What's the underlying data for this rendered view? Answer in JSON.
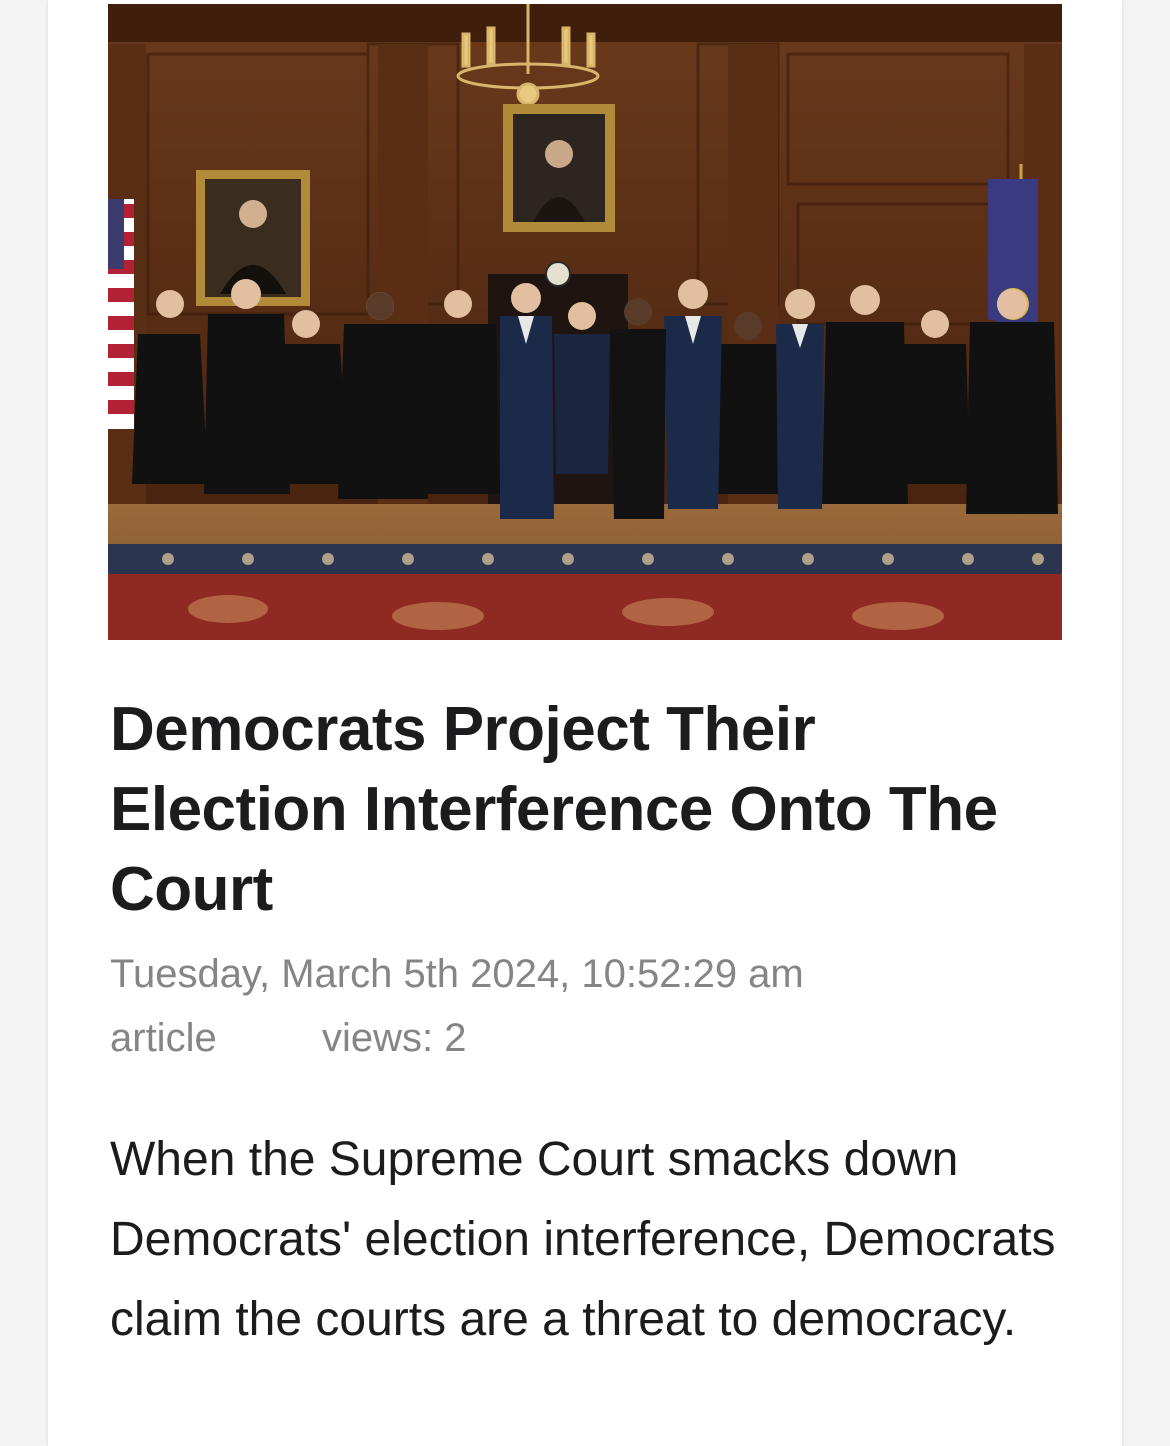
{
  "article": {
    "image_alt": "Group photo in a wood-paneled room with chandelier, portraits and flags",
    "title": "Democrats Project Their Election Interference Onto The Court",
    "date": "Tuesday, March 5th 2024, 10:52:29 am",
    "category": "article",
    "views": "views: 2",
    "body": "When the Supreme Court smacks down Democrats' election interference, Democrats claim the courts are a threat to democracy."
  },
  "colors": {
    "background": "#f4f4f4",
    "card": "#ffffff",
    "text": "#1c1c1e",
    "meta": "#858585"
  }
}
